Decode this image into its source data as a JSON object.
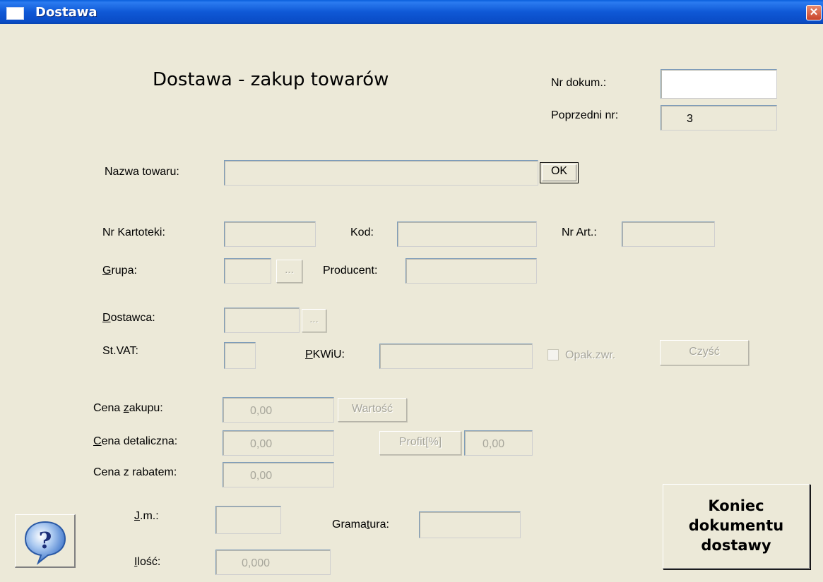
{
  "window": {
    "title": "Dostawa",
    "close_glyph": "✕"
  },
  "heading": "Dostawa - zakup towarów",
  "doc": {
    "nr_dokum_label": "Nr dokum.:",
    "nr_dokum_value": "",
    "poprzedni_label": "Poprzedni nr:",
    "poprzedni_value": "3"
  },
  "product": {
    "nazwa_label": "Nazwa towaru:",
    "nazwa_value": "",
    "ok_label": "OK"
  },
  "fields": {
    "nr_kartoteki_label": "Nr Kartoteki:",
    "kod_label": "Kod:",
    "nr_art_label": "Nr Art.:",
    "grupa_label_pre": "",
    "grupa_label_u": "G",
    "grupa_label_post": "rupa:",
    "producent_label": "Producent:",
    "dostawca_label_u": "D",
    "dostawca_label_post": "ostawca:",
    "st_vat_label": "St.VAT:",
    "pkwiu_label_u": "P",
    "pkwiu_label_post": "KWiU:",
    "opak_label": "Opak.zwr.",
    "czysc_label": "Czyść",
    "browse_label": "..."
  },
  "prices": {
    "cena_zakupu_pre": "Cena ",
    "cena_zakupu_u": "z",
    "cena_zakupu_post": "akupu:",
    "cena_zakupu_value": "0,00",
    "wartosc_label": "Wartość",
    "cena_det_u": "C",
    "cena_det_post": "ena detaliczna:",
    "cena_det_value": "0,00",
    "profit_label": "Profit[%]",
    "profit_value": "0,00",
    "cena_rabat_label": "Cena z rabatem:",
    "cena_rabat_value": "0,00"
  },
  "units": {
    "jm_u": "J",
    "jm_post": ".m.:",
    "gramatura_pre": "Grama",
    "gramatura_u": "t",
    "gramatura_post": "ura:",
    "ilosc_u": "I",
    "ilosc_post": "lość:",
    "ilosc_value": "0,000"
  },
  "end_button": {
    "line1": "Koniec",
    "line2": "dokumentu",
    "line3": "dostawy"
  },
  "help_icon": "help-question-icon"
}
